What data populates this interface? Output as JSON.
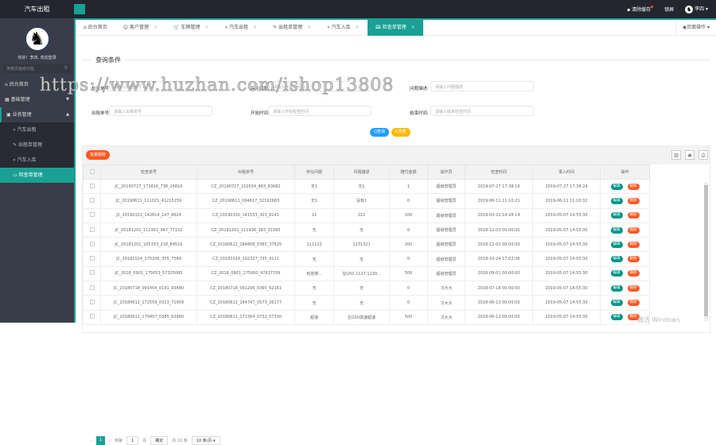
{
  "app": {
    "title": "汽车出租"
  },
  "topbar": {
    "clear_cache": "清除缓存",
    "lock": "锁屏",
    "user": "李四"
  },
  "sidebar": {
    "greeting": "你好！李四, 欢迎登录",
    "search_placeholder": "搜索页面或功能",
    "items": [
      {
        "label": "后台首页"
      },
      {
        "label": "基础管理"
      },
      {
        "label": "业务管理"
      }
    ],
    "sub_items": [
      {
        "label": "汽车出租"
      },
      {
        "label": "出租单管理"
      },
      {
        "label": "汽车入库"
      },
      {
        "label": "检查单管理"
      }
    ]
  },
  "tabs": [
    {
      "label": "后台首页",
      "icon": "⌂"
    },
    {
      "label": "客户管理",
      "icon": "☺"
    },
    {
      "label": "车辆管理",
      "icon": "🛒"
    },
    {
      "label": "汽车出租",
      "icon": "»"
    },
    {
      "label": "出租单管理",
      "icon": "✎"
    },
    {
      "label": "汽车入库",
      "icon": "«"
    },
    {
      "label": "检查单管理",
      "icon": "🕮"
    }
  ],
  "page_ops": "页面操作",
  "query": {
    "title": "查询条件",
    "fields": [
      {
        "label": "检查单号:",
        "placeholder": "请输入检查单号"
      },
      {
        "label": "存在问题:",
        "placeholder": "请输入存在的问题"
      },
      {
        "label": "问题描述:",
        "placeholder": "请输入问题描述"
      },
      {
        "label": "出租单号:",
        "placeholder": "请输入出租单号"
      },
      {
        "label": "开始时间:",
        "placeholder": "请输入开始检查时间"
      },
      {
        "label": "结束时间:",
        "placeholder": "请输入结束检查时间"
      }
    ],
    "search": "Q查询",
    "reset": "C重置"
  },
  "table": {
    "batch_delete": "批量删除",
    "headers": [
      "检查单号",
      "出租单号",
      "存在问题",
      "问题描述",
      "赔付金额",
      "操作员",
      "检查时间",
      "录入时间",
      "操作"
    ],
    "edit": "编辑",
    "delete": "删除",
    "rows": [
      [
        "JC_20190727_173816_738_26810",
        "CZ_20190727_152634_863_83682",
        "无1",
        "无1",
        "1",
        "超级管理员",
        "2019-07-27 17:38:16",
        "2019-07-27 17:38:24"
      ],
      [
        "JC_20190611_111021_41215259",
        "CZ_20190611_094617_32192683",
        "无1",
        "没有1",
        "0",
        "超级管理员",
        "2019-06-11 11:10:21",
        "2019-06-11 11:10:32"
      ],
      [
        "JC_20190322_142814_147_8624",
        "CZ_20190320_141553_303_8141",
        "11",
        "222",
        "100",
        "超级管理员",
        "2019-03-22 14:28:14",
        "2019-05-07 14:55:30"
      ],
      [
        "JC_20181201_111951_947_77152",
        "CZ_20181201_111936_383_31565",
        "无",
        "无",
        "0",
        "超级管理员",
        "2018-12-03 00:00:00",
        "2019-05-07 14:55:30"
      ],
      [
        "JC_20181201_105333_218_89516",
        "CZ_20180612_164808_0385_37625",
        "111122",
        "1231321",
        "200",
        "超级管理员",
        "2018-12-02 00:00:00",
        "2019-05-07 14:55:30"
      ],
      [
        "JC_20181024_170206_355_7589",
        "CZ_20181024_102327_735_9111",
        "无",
        "无",
        "0",
        "超级管理员",
        "2018-10-24 17:02:06",
        "2019-05-07 14:55:30"
      ],
      [
        "JC_2018_0901_175053_57325085",
        "CZ_2018_0901_175000_97637709",
        "有挂擦...",
        "在G50 1127-1130...",
        "500",
        "超级管理员",
        "2018-09-01 00:00:00",
        "2019-05-07 14:55:30"
      ],
      [
        "JC_20180718_091454_0191_93480",
        "CZ_20180718_091206_0365_62161",
        "无",
        "无",
        "0",
        "习大大",
        "2018-07-18 00:00:00",
        "2019-05-07 14:55:30"
      ],
      [
        "JC_20180612_172559_0323_71959",
        "CZ_20180612_164747_0573_26177",
        "无",
        "无",
        "0",
        "习大大",
        "2018-06-13 00:00:00",
        "2019-05-07 14:55:30"
      ],
      [
        "JC_20180612_170407_0385_63960",
        "CZ_20180611_171304_0732_57330",
        "超速",
        "在G50高速超速",
        "500",
        "习大大",
        "2018-06-12 00:00:00",
        "2019-05-07 14:55:30"
      ]
    ]
  },
  "pager": {
    "current": "1",
    "goto": "到第",
    "page_input": "1",
    "page_unit": "页",
    "confirm": "确定",
    "total": "共 10 条",
    "page_size": "10 条/页"
  },
  "watermark": "https://www.huzhan.com/ishop13808",
  "activation": "激活 Windows"
}
